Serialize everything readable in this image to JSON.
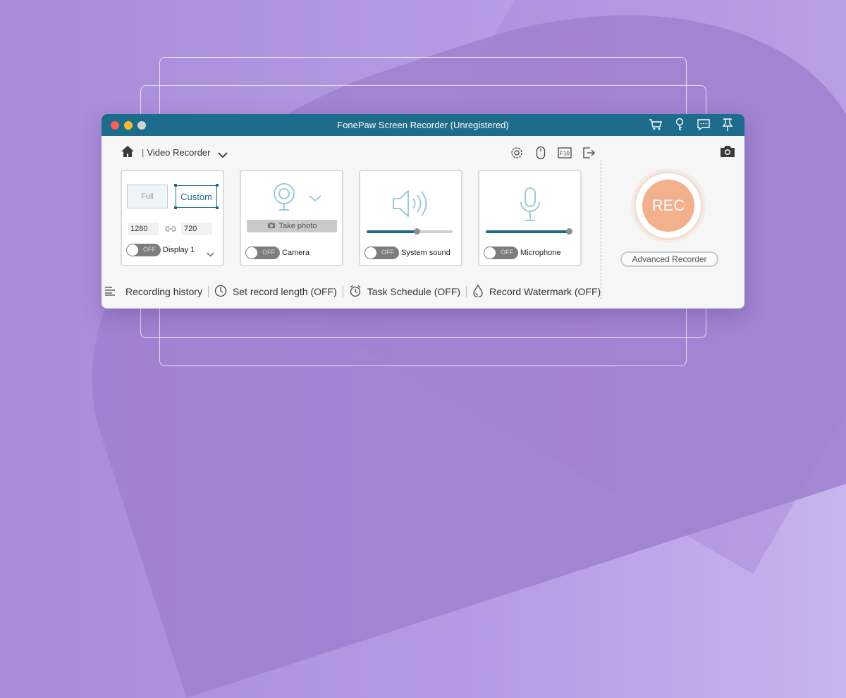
{
  "window": {
    "title": "FonePaw Screen Recorder (Unregistered)"
  },
  "toolbar": {
    "mode_label": "Video Recorder",
    "separator": "|"
  },
  "capture": {
    "full_label": "Full",
    "custom_label": "Custom",
    "width": "1280",
    "height": "720",
    "display_label": "Display 1",
    "toggle": "OFF"
  },
  "camera": {
    "take_photo": "Take photo",
    "label": "Camera",
    "toggle": "OFF"
  },
  "system_sound": {
    "label": "System sound",
    "toggle": "OFF",
    "volume": 0.58
  },
  "microphone": {
    "label": "Microphone",
    "toggle": "OFF",
    "volume": 0.97
  },
  "rec": {
    "label": "REC",
    "advanced": "Advanced Recorder"
  },
  "bottom": {
    "history": "Recording history",
    "length": "Set record length (OFF)",
    "schedule": "Task Schedule (OFF)",
    "watermark": "Record Watermark (OFF)"
  },
  "colors": {
    "accent": "#1d6c8c",
    "rec": "#f2b08c"
  }
}
